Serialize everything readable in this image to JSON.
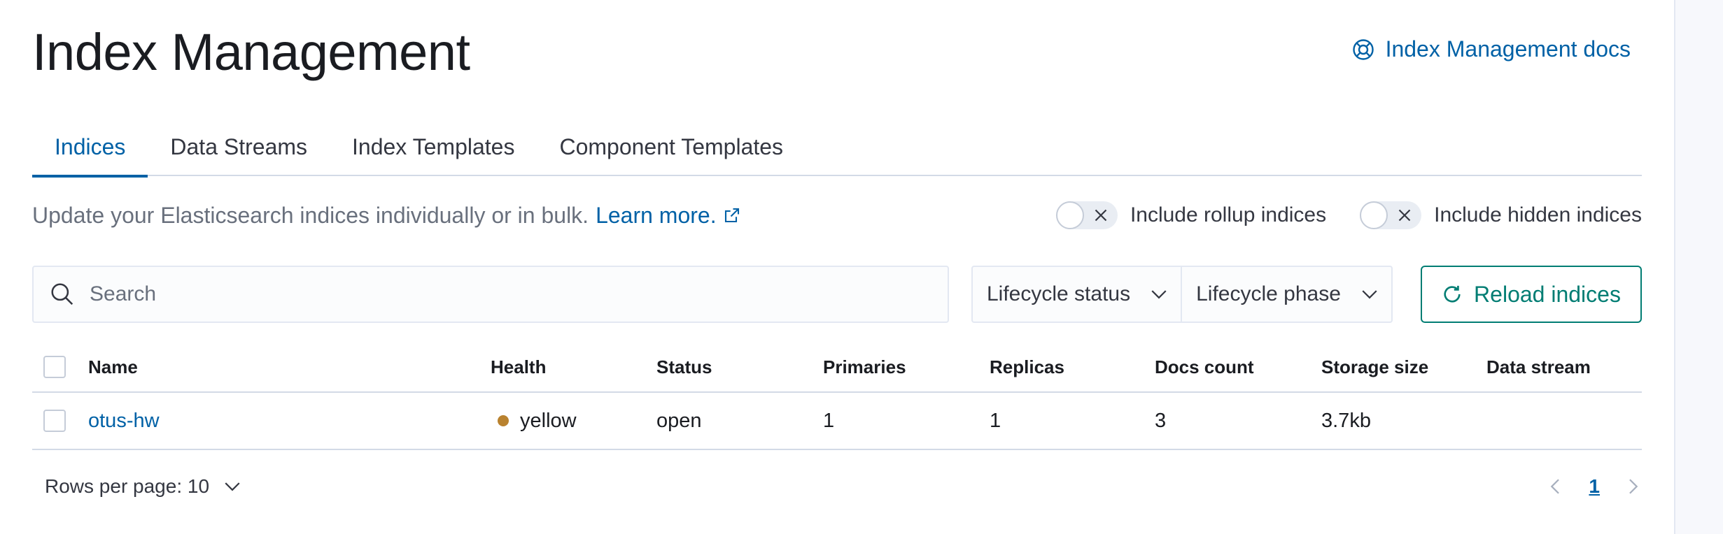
{
  "page": {
    "title": "Index Management",
    "docs_link": "Index Management docs"
  },
  "tabs": [
    {
      "label": "Indices",
      "active": true
    },
    {
      "label": "Data Streams",
      "active": false
    },
    {
      "label": "Index Templates",
      "active": false
    },
    {
      "label": "Component Templates",
      "active": false
    }
  ],
  "description": {
    "text": "Update your Elasticsearch indices individually or in bulk.",
    "learn_more": "Learn more."
  },
  "toggles": {
    "rollup": {
      "label": "Include rollup indices",
      "on": false
    },
    "hidden": {
      "label": "Include hidden indices",
      "on": false
    }
  },
  "search": {
    "placeholder": "Search",
    "value": ""
  },
  "filters": {
    "lifecycle_status": "Lifecycle status",
    "lifecycle_phase": "Lifecycle phase"
  },
  "reload_button": "Reload indices",
  "table": {
    "columns": {
      "name": "Name",
      "health": "Health",
      "status": "Status",
      "primaries": "Primaries",
      "replicas": "Replicas",
      "docs_count": "Docs count",
      "storage_size": "Storage size",
      "data_stream": "Data stream"
    },
    "rows": [
      {
        "name": "otus-hw",
        "health": "yellow",
        "status": "open",
        "primaries": "1",
        "replicas": "1",
        "docs_count": "3",
        "storage_size": "3.7kb",
        "data_stream": ""
      }
    ]
  },
  "pagination": {
    "rows_per_page": "Rows per page: 10",
    "current_page": "1"
  },
  "colors": {
    "link": "#0061a6",
    "accent_green": "#017d73",
    "health_yellow": "#b9822f"
  }
}
